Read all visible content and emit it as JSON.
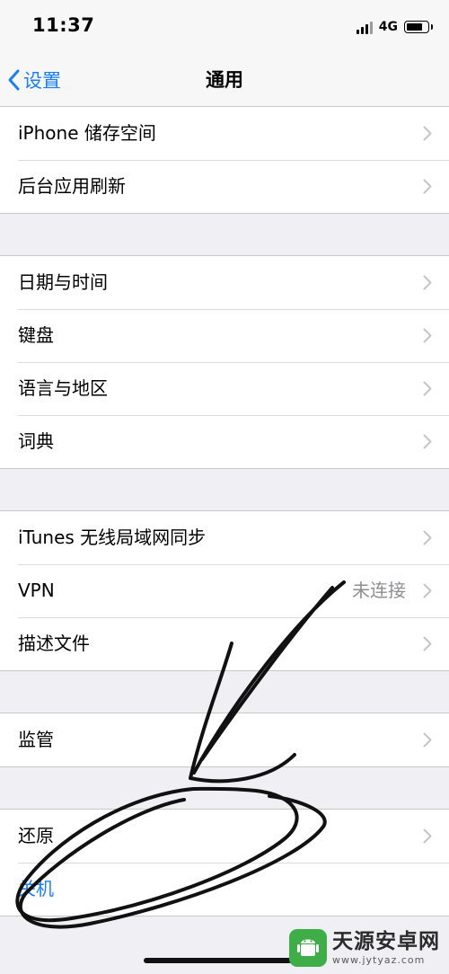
{
  "status_bar": {
    "time": "11:37",
    "network": "4G"
  },
  "nav": {
    "back_label": "设置",
    "title": "通用"
  },
  "groups": [
    {
      "rows": [
        {
          "label": "iPhone 储存空间"
        },
        {
          "label": "后台应用刷新"
        }
      ]
    },
    {
      "rows": [
        {
          "label": "日期与时间"
        },
        {
          "label": "键盘"
        },
        {
          "label": "语言与地区"
        },
        {
          "label": "词典"
        }
      ]
    },
    {
      "rows": [
        {
          "label": "iTunes 无线局域网同步"
        },
        {
          "label": "VPN",
          "value": "未连接"
        },
        {
          "label": "描述文件"
        }
      ]
    },
    {
      "rows": [
        {
          "label": "监管"
        }
      ]
    },
    {
      "rows": [
        {
          "label": "还原"
        },
        {
          "label": "关机"
        }
      ]
    }
  ],
  "watermark": {
    "title": "天源安卓网",
    "url": "www.jytyaz.com"
  },
  "colors": {
    "accent": "#1a7ef7",
    "background": "#efeff4",
    "watermark_green": "#3fae49"
  },
  "icons": {
    "back": "chevron-left-icon",
    "row": "chevron-right-icon"
  }
}
